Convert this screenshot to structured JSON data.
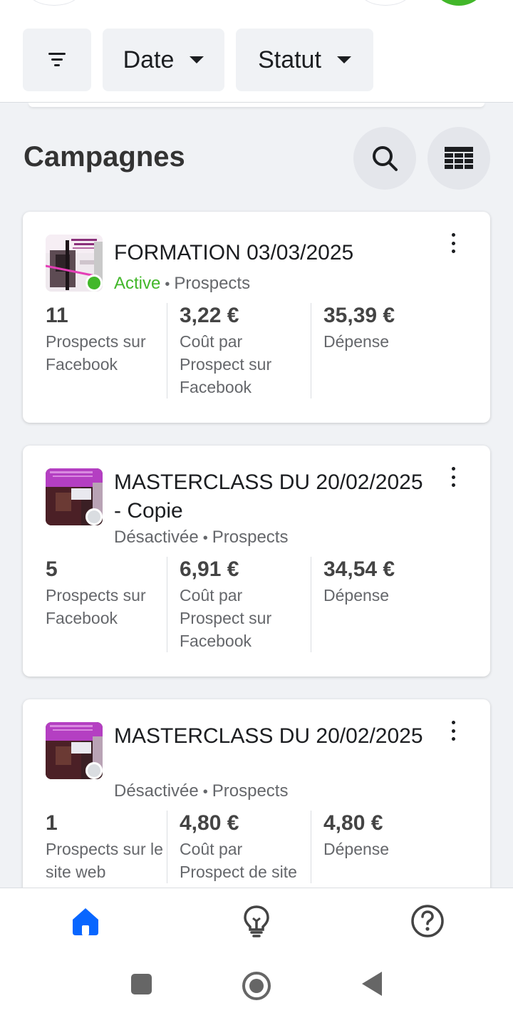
{
  "filters": {
    "date_label": "Date",
    "status_label": "Statut"
  },
  "section": {
    "title": "Campagnes"
  },
  "campaigns": [
    {
      "title": "FORMATION 03/03/2025",
      "status": "Active",
      "type": "Prospects",
      "metrics": [
        {
          "value": "11",
          "label": "Prospects sur Facebook"
        },
        {
          "value": "3,22 €",
          "label": "Coût par Prospect sur Facebook"
        },
        {
          "value": "35,39 €",
          "label": "Dépense"
        }
      ]
    },
    {
      "title": "MASTERCLASS DU 20/02/2025 - Copie",
      "status": "Désactivée",
      "type": "Prospects",
      "metrics": [
        {
          "value": "5",
          "label": "Prospects sur Facebook"
        },
        {
          "value": "6,91 €",
          "label": "Coût par Prospect sur Facebook"
        },
        {
          "value": "34,54 €",
          "label": "Dépense"
        }
      ]
    },
    {
      "title": "MASTERCLASS DU 20/02/2025",
      "status": "Désactivée",
      "type": "Prospects",
      "metrics": [
        {
          "value": "1",
          "label": "Prospects sur le site web"
        },
        {
          "value": "4,80 €",
          "label": "Coût par Prospect de site"
        },
        {
          "value": "4,80 €",
          "label": "Dépense"
        }
      ]
    }
  ],
  "colors": {
    "active": "#42b72a",
    "brand": "#0866ff",
    "muted": "#65676b"
  },
  "icons": {
    "filter": "filter-icon",
    "search": "search-icon",
    "table": "table-icon",
    "more": "more-vertical-icon",
    "home": "home-icon",
    "tips": "lightbulb-icon",
    "help": "question-circle-icon"
  }
}
